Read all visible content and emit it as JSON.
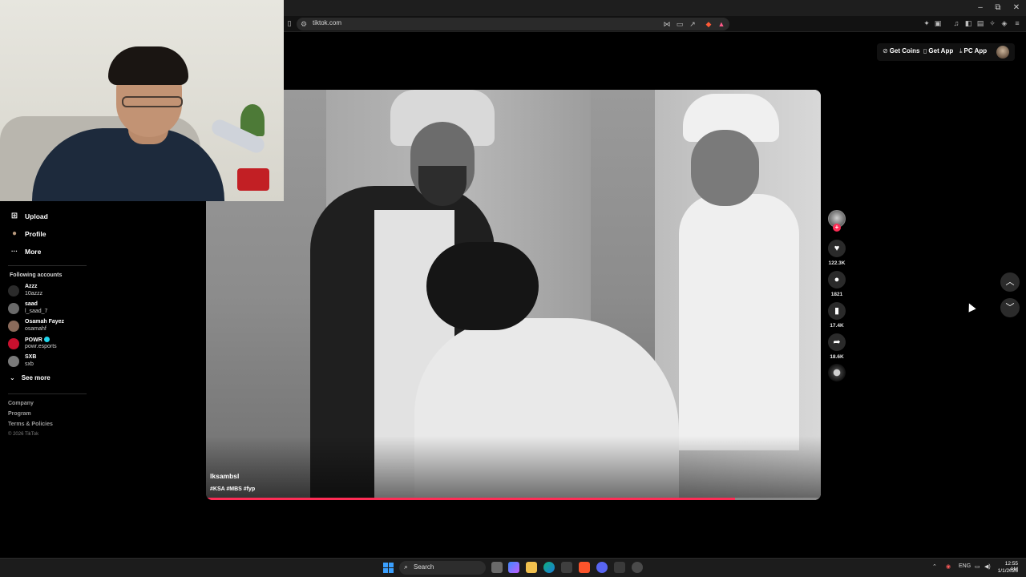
{
  "browser": {
    "url": "tiktok.com",
    "window_controls": {
      "minimize": "–",
      "restore": "⧉",
      "close": "✕"
    }
  },
  "header": {
    "get_coins": "Get Coins",
    "get_app": "Get App",
    "pc_app": "PC App"
  },
  "sidebar": {
    "nav": [
      {
        "icon": "plus-square-icon",
        "glyph": "⊞",
        "label": "Upload"
      },
      {
        "icon": "profile-icon",
        "glyph": "●",
        "label": "Profile"
      },
      {
        "icon": "more-icon",
        "glyph": "···",
        "label": "More"
      }
    ],
    "following_heading": "Following accounts",
    "accounts": [
      {
        "name": "Azzz",
        "handle": "10azzz",
        "verified": false,
        "color": "#2b2b2b"
      },
      {
        "name": "saad",
        "handle": "l_saad_7",
        "verified": false,
        "color": "#6a6a6a"
      },
      {
        "name": "Osamah Fayez",
        "handle": "osamahf",
        "verified": false,
        "color": "#8a6a5a"
      },
      {
        "name": "POWR",
        "handle": "powr.esports",
        "verified": true,
        "color": "#c8102e"
      },
      {
        "name": "SXB",
        "handle": "sxb",
        "verified": false,
        "color": "#7a7a7a"
      }
    ],
    "see_more": "See more",
    "footer_links": [
      "Company",
      "Program",
      "Terms & Policies"
    ],
    "copyright": "© 2026 TikTok"
  },
  "video": {
    "author": "lksambsl",
    "caption": "#KSA #MBS #fyp",
    "progress": 0.86
  },
  "actions": {
    "likes": "122.3K",
    "comments": "1821",
    "saves": "17.4K",
    "shares": "18.6K"
  },
  "taskbar": {
    "search_placeholder": "Search",
    "language": "ENG",
    "time": "12:55 AM",
    "date": "1/1/2026"
  }
}
